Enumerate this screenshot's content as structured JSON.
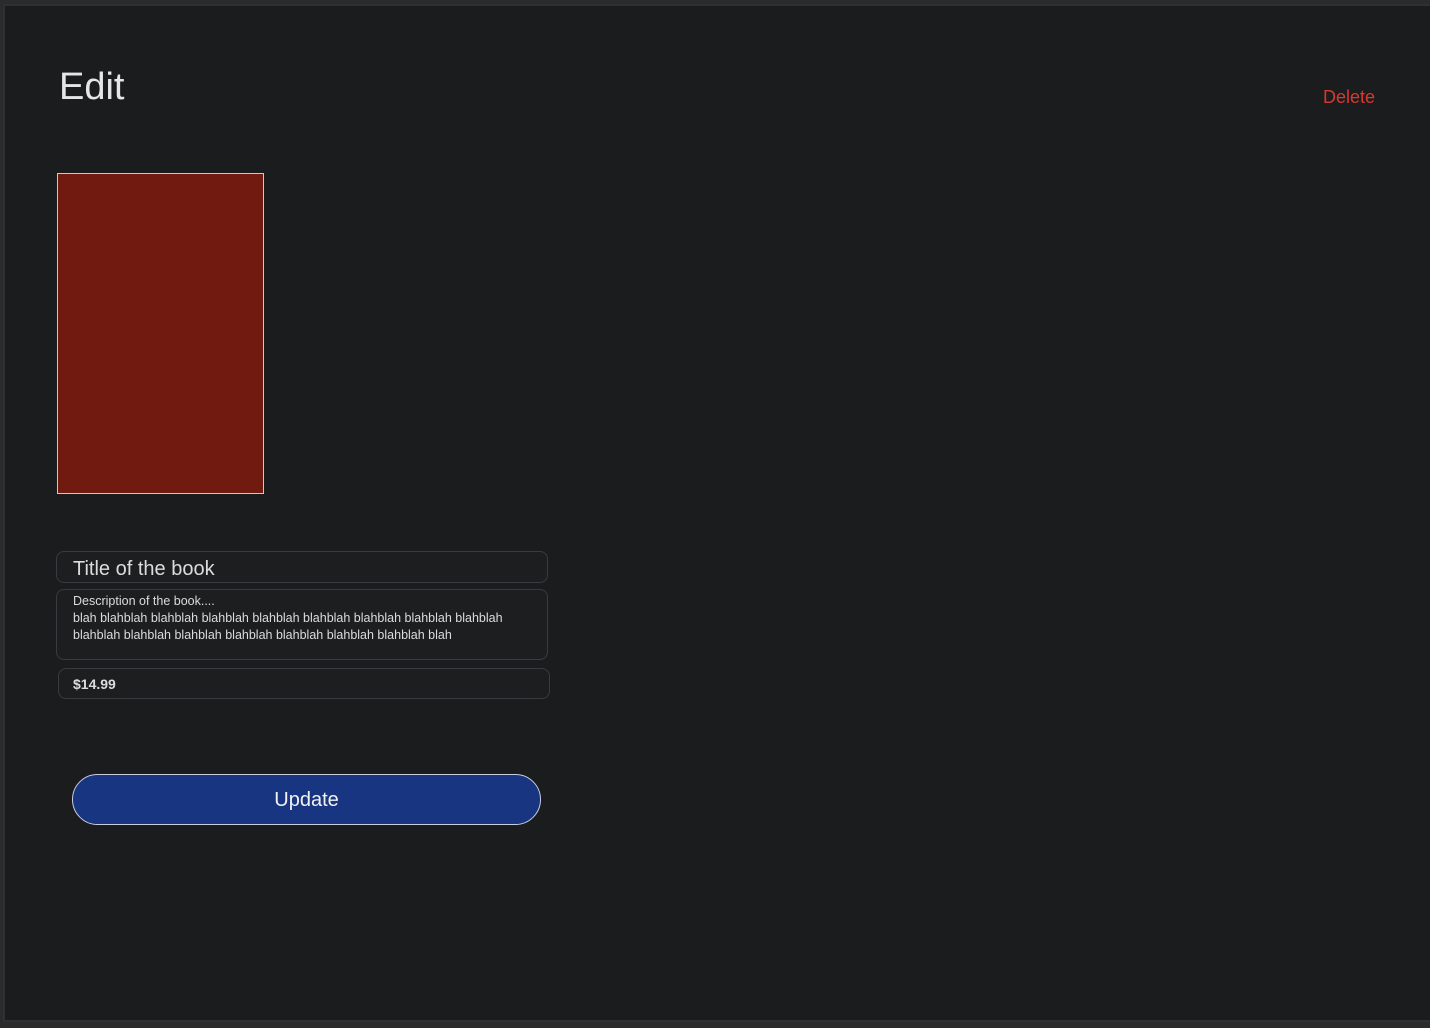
{
  "page": {
    "title": "Edit",
    "delete_label": "Delete"
  },
  "book": {
    "cover_color": "#701a10",
    "title": "Title of the book",
    "description": "Description of the book....\nblah blahblah blahblah blahblah blahblah blahblah blahblah blahblah blahblah blahblah blahblah blahblah blahblah blahblah blahblah blahblah blah",
    "price": "$14.99"
  },
  "actions": {
    "update_label": "Update"
  },
  "colors": {
    "background": "#1b1c1e",
    "delete": "#d9382f",
    "update_button": "#173580"
  }
}
